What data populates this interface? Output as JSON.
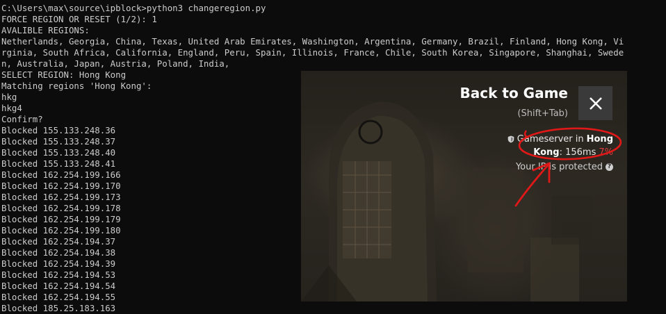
{
  "terminal": {
    "lines": [
      "C:\\Users\\max\\source\\ipblock>python3 changeregion.py",
      "FORCE REGION OR RESET (1/2): 1",
      "AVALIBLE REGIONS:",
      "Netherlands, Georgia, China, Texas, United Arab Emirates, Washington, Argentina, Germany, Brazil, Finland, Hong Kong, Vi",
      "rginia, South Africa, California, England, Peru, Spain, Illinois, France, Chile, South Korea, Singapore, Shanghai, Swede",
      "n, Australia, Japan, Austria, Poland, India,",
      "SELECT REGION: Hong Kong",
      "Matching regions 'Hong Kong':",
      "hkg",
      "hkg4",
      "Confirm?",
      "Blocked 155.133.248.36",
      "Blocked 155.133.248.37",
      "Blocked 155.133.248.40",
      "Blocked 155.133.248.41",
      "Blocked 162.254.199.166",
      "Blocked 162.254.199.170",
      "Blocked 162.254.199.173",
      "Blocked 162.254.199.178",
      "Blocked 162.254.199.179",
      "Blocked 162.254.199.180",
      "Blocked 162.254.194.37",
      "Blocked 162.254.194.38",
      "Blocked 162.254.194.39",
      "Blocked 162.254.194.53",
      "Blocked 162.254.194.54",
      "Blocked 162.254.194.55",
      "Blocked 185.25.183.163"
    ]
  },
  "overlay": {
    "title": "Back to Game",
    "shortcut": "(Shift+Tab)",
    "close_icon": "close-x-icon",
    "server_prefix": "Gameserver in",
    "region_part1": "Hong",
    "region_part2": "Kong",
    "ping": ": 156ms",
    "loss": "7%",
    "protected_text": "Your IP is protected",
    "help_icon_glyph": "?",
    "shield_icon": "shield-icon"
  },
  "colors": {
    "terminal_bg": "#0c0c0c",
    "terminal_text": "#cccccc",
    "annotation_red": "#e01818",
    "loss_red": "#d93a3a"
  }
}
